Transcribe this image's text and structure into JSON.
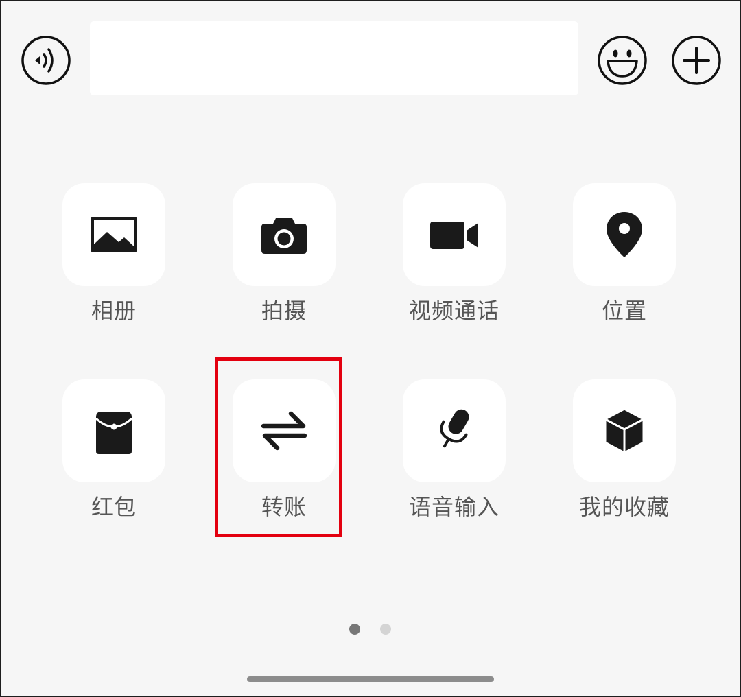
{
  "input_bar": {
    "voice_button_icon": "voice-icon",
    "message_value": "",
    "emoji_button_icon": "emoji-icon",
    "more_button_icon": "plus-icon"
  },
  "actions": [
    {
      "label": "相册",
      "icon": "album-icon"
    },
    {
      "label": "拍摄",
      "icon": "camera-icon"
    },
    {
      "label": "视频通话",
      "icon": "video-call-icon"
    },
    {
      "label": "位置",
      "icon": "location-icon"
    },
    {
      "label": "红包",
      "icon": "red-packet-icon"
    },
    {
      "label": "转账",
      "icon": "transfer-icon"
    },
    {
      "label": "语音输入",
      "icon": "microphone-icon"
    },
    {
      "label": "我的收藏",
      "icon": "favorites-icon"
    }
  ],
  "highlighted_action_index": 5,
  "pagination": {
    "page_count": 2,
    "current_page": 1
  },
  "colors": {
    "background": "#f6f6f6",
    "tile": "#ffffff",
    "icon": "#1a1a1a",
    "label": "#555555",
    "highlight": "#e3000f",
    "dot_active": "#777777",
    "dot_inactive": "#d4d4d4",
    "home_indicator": "#8c8c8c"
  }
}
